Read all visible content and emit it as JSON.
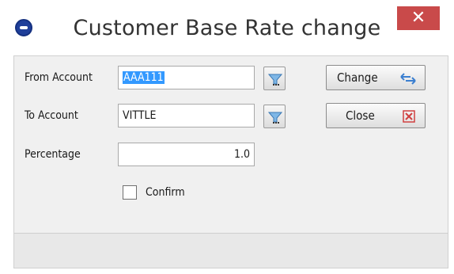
{
  "window": {
    "title": "Customer Base Rate change",
    "close_glyph": "✕"
  },
  "form": {
    "from_account": {
      "label": "From Account",
      "value": "AAA111"
    },
    "to_account": {
      "label": "To Account",
      "value": "VITTLE"
    },
    "percentage": {
      "label": "Percentage",
      "value": "1.0"
    },
    "confirm": {
      "label": "Confirm",
      "checked": false
    }
  },
  "buttons": {
    "change": "Change",
    "close": "Close"
  },
  "icons": {
    "app": "app-logo-icon",
    "lookup": "funnel-lookup-icon",
    "change": "swap-arrows-icon",
    "close": "red-x-icon"
  },
  "colors": {
    "close_button": "#c94a4a",
    "selection": "#3399ff",
    "panel": "#f0f0f0"
  }
}
